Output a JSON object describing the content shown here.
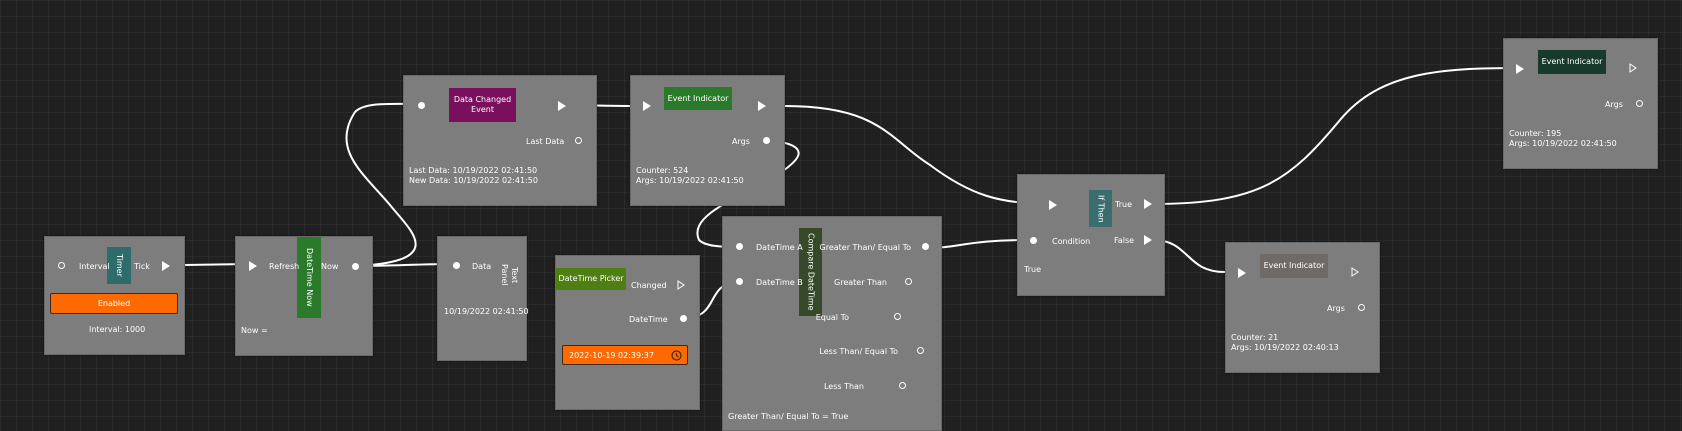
{
  "colors": {
    "canvas": "#202020",
    "node": "#7d7d7d",
    "timer_title": "#2e6b6b",
    "datetime_now_title": "#2b7a2b",
    "data_changed_title": "#7a0f5e",
    "event_indicator_title": "#2b7a2b",
    "event_indicator_top_title": "#173a2c",
    "event_indicator_bottom_title": "#6f6a66",
    "datetime_picker_title": "#4f7e12",
    "compare_title": "#364a2a",
    "ifthen_title": "#3a6e6e",
    "accent": "#ff6a00"
  },
  "timer": {
    "title": "Timer",
    "input_label": "Interval",
    "output_label": "Tick",
    "enabled_button": "Enabled",
    "status": "Interval: 1000",
    "icons": {
      "input": "circle-port-icon",
      "output": "play-icon"
    }
  },
  "datetime_now": {
    "title": "DateTime Now",
    "input_label": "Refresh",
    "output_label": "Now",
    "status": "Now ="
  },
  "text_panel": {
    "title": "Text Panel",
    "input_label": "Data",
    "value": "10/19/2022 02:41:50"
  },
  "data_changed": {
    "title": "Data Changed Event",
    "output_label": "Last Data",
    "status_last": "Last Data: 10/19/2022 02:41:50",
    "status_new": "New Data: 10/19/2022 02:41:50"
  },
  "event_indicator_mid": {
    "title": "Event Indicator",
    "output_label": "Args",
    "status_counter": "Counter: 524",
    "status_args": "Args: 10/19/2022 02:41:50"
  },
  "datetime_picker": {
    "title": "DateTime Picker",
    "output_changed": "Changed",
    "output_datetime": "DateTime",
    "value": "2022-10-19 02:39:37",
    "icons": {
      "clock": "clock-icon"
    }
  },
  "compare_datetime": {
    "title": "Compare DateTime",
    "input_a": "DateTime A",
    "input_b": "DateTime B",
    "outputs": [
      "Greater Than/ Equal To",
      "Greater Than",
      "Equal To",
      "Less Than/ Equal To",
      "Less Than"
    ],
    "status": "Greater Than/ Equal To = True"
  },
  "if_then": {
    "title": "If Then",
    "input_label": "Condition",
    "output_true": "True",
    "output_false": "False",
    "status": "True"
  },
  "event_indicator_top": {
    "title": "Event Indicator",
    "output_label": "Args",
    "status_counter": "Counter: 195",
    "status_args": "Args: 10/19/2022 02:41:50"
  },
  "event_indicator_bottom": {
    "title": "Event Indicator",
    "output_label": "Args",
    "status_counter": "Counter: 21",
    "status_args": "Args: 10/19/2022 02:40:13"
  }
}
